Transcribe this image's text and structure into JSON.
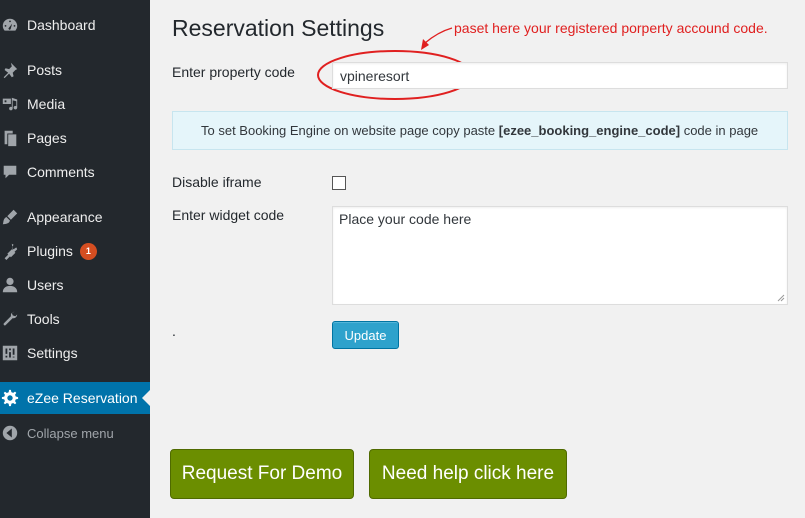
{
  "sidebar": {
    "items": [
      {
        "label": "Dashboard",
        "icon": "dashboard-icon"
      },
      {
        "label": "Posts",
        "icon": "pin-icon"
      },
      {
        "label": "Media",
        "icon": "media-icon"
      },
      {
        "label": "Pages",
        "icon": "pages-icon"
      },
      {
        "label": "Comments",
        "icon": "comment-icon"
      },
      {
        "label": "Appearance",
        "icon": "brush-icon"
      },
      {
        "label": "Plugins",
        "icon": "plugin-icon",
        "badge": "1"
      },
      {
        "label": "Users",
        "icon": "user-icon"
      },
      {
        "label": "Tools",
        "icon": "wrench-icon"
      },
      {
        "label": "Settings",
        "icon": "sliders-icon"
      },
      {
        "label": "eZee Reservation",
        "icon": "gear-icon"
      }
    ],
    "collapse_label": "Collapse menu",
    "active_color": "#0073aa"
  },
  "main": {
    "title": "Reservation Settings",
    "annotation": "paset here your registered porperty accound code.",
    "property_code": {
      "label": "Enter property code",
      "value": "vpineresort"
    },
    "notice": {
      "prefix": "To set Booking Engine on website page copy paste ",
      "code": "[ezee_booking_engine_code]",
      "suffix": " code in page"
    },
    "disable_iframe": {
      "label": "Disable iframe",
      "checked": false
    },
    "widget_code": {
      "label": "Enter widget code",
      "value": "Place your code here"
    },
    "dot": ".",
    "update_label": "Update",
    "demo_label": "Request For Demo",
    "help_label": "Need help click here"
  },
  "colors": {
    "annotation": "#e02020",
    "update_button": "#2ea2cc",
    "green_button": "#6b8e00"
  }
}
